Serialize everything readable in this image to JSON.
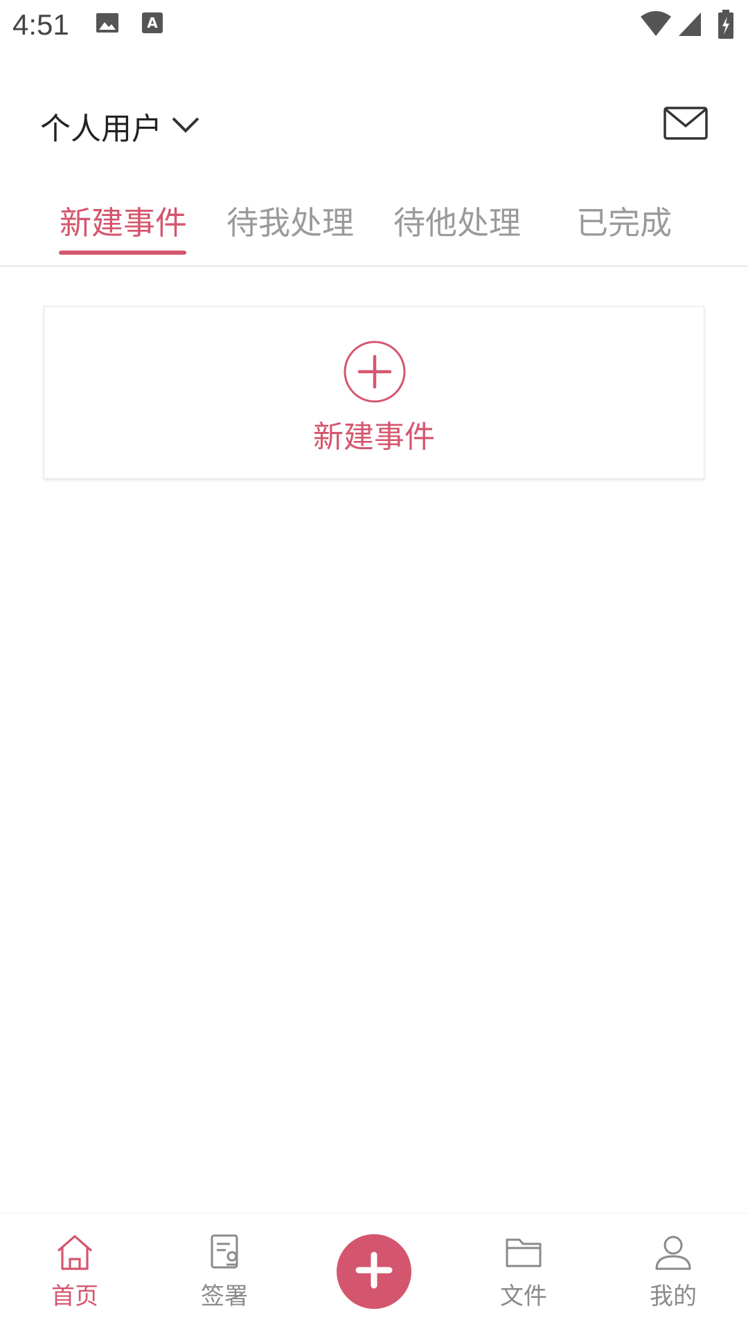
{
  "status_bar": {
    "time": "4:51",
    "left_icons": [
      "image-icon",
      "a-text-icon"
    ],
    "right_icons": [
      "wifi-icon",
      "cellular-signal-icon",
      "battery-charging-icon"
    ]
  },
  "header": {
    "account_label": "个人用户",
    "account_icon": "chevron-down-icon",
    "mail_icon": "mail-icon"
  },
  "tabs": [
    {
      "label": "新建事件",
      "active": true
    },
    {
      "label": "待我处理",
      "active": false
    },
    {
      "label": "待他处理",
      "active": false
    },
    {
      "label": "已完成",
      "active": false
    }
  ],
  "new_event_card": {
    "icon": "plus-circle-icon",
    "label": "新建事件"
  },
  "bottom_nav": {
    "items": [
      {
        "label": "首页",
        "icon": "home-icon",
        "active": true
      },
      {
        "label": "签署",
        "icon": "sign-document-icon",
        "active": false
      },
      {
        "label": "文件",
        "icon": "folder-icon",
        "active": false
      },
      {
        "label": "我的",
        "icon": "user-icon",
        "active": false
      }
    ],
    "fab_icon": "plus-icon"
  },
  "colors": {
    "accent": "#d4566e",
    "inactive_text": "#9a9a9a",
    "divider": "#eeeeee"
  }
}
